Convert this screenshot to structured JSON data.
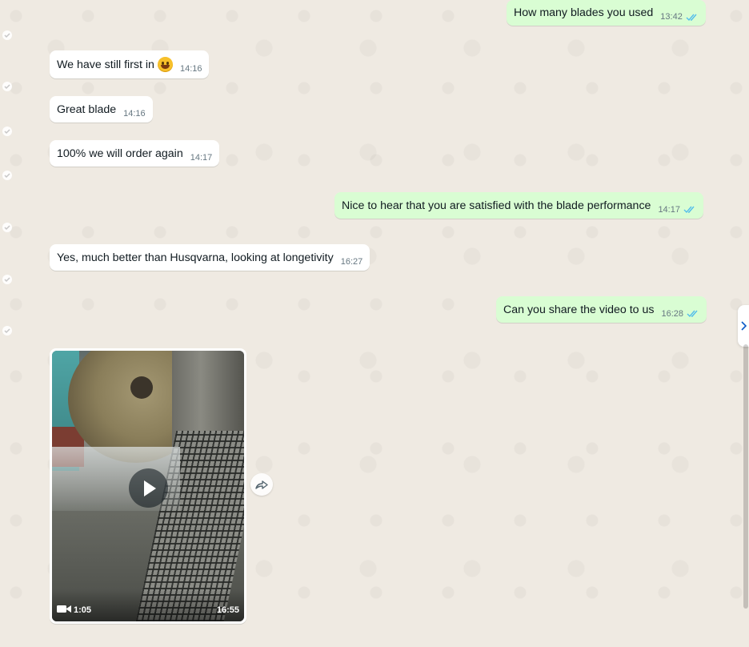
{
  "colors": {
    "incoming": "#ffffff",
    "outgoing": "#d9fdd3",
    "read_ticks": "#53bdeb",
    "background": "#efeae2"
  },
  "messages": [
    {
      "direction": "out",
      "text": "How many blades you used",
      "time": "13:42",
      "status": "read"
    },
    {
      "direction": "in",
      "text": "We have still first in",
      "emoji": "grinning-face",
      "time": "14:16"
    },
    {
      "direction": "in",
      "text": "Great blade",
      "time": "14:16"
    },
    {
      "direction": "in",
      "text": "100% we will order again",
      "time": "14:17"
    },
    {
      "direction": "out",
      "text": "Nice to hear that you are satisfied with the blade performance",
      "time": "14:17",
      "status": "read"
    },
    {
      "direction": "in",
      "text": "Yes, much better than Husqvarna, looking at longetivity",
      "time": "16:27"
    },
    {
      "direction": "out",
      "text": "Can you share the video to us",
      "time": "16:28",
      "status": "read"
    }
  ],
  "video": {
    "duration": "1:05",
    "time": "16:55",
    "icons": [
      "play-icon",
      "video-camera-icon",
      "forward-icon"
    ]
  },
  "side_panel_icon": "chevron-right-icon"
}
